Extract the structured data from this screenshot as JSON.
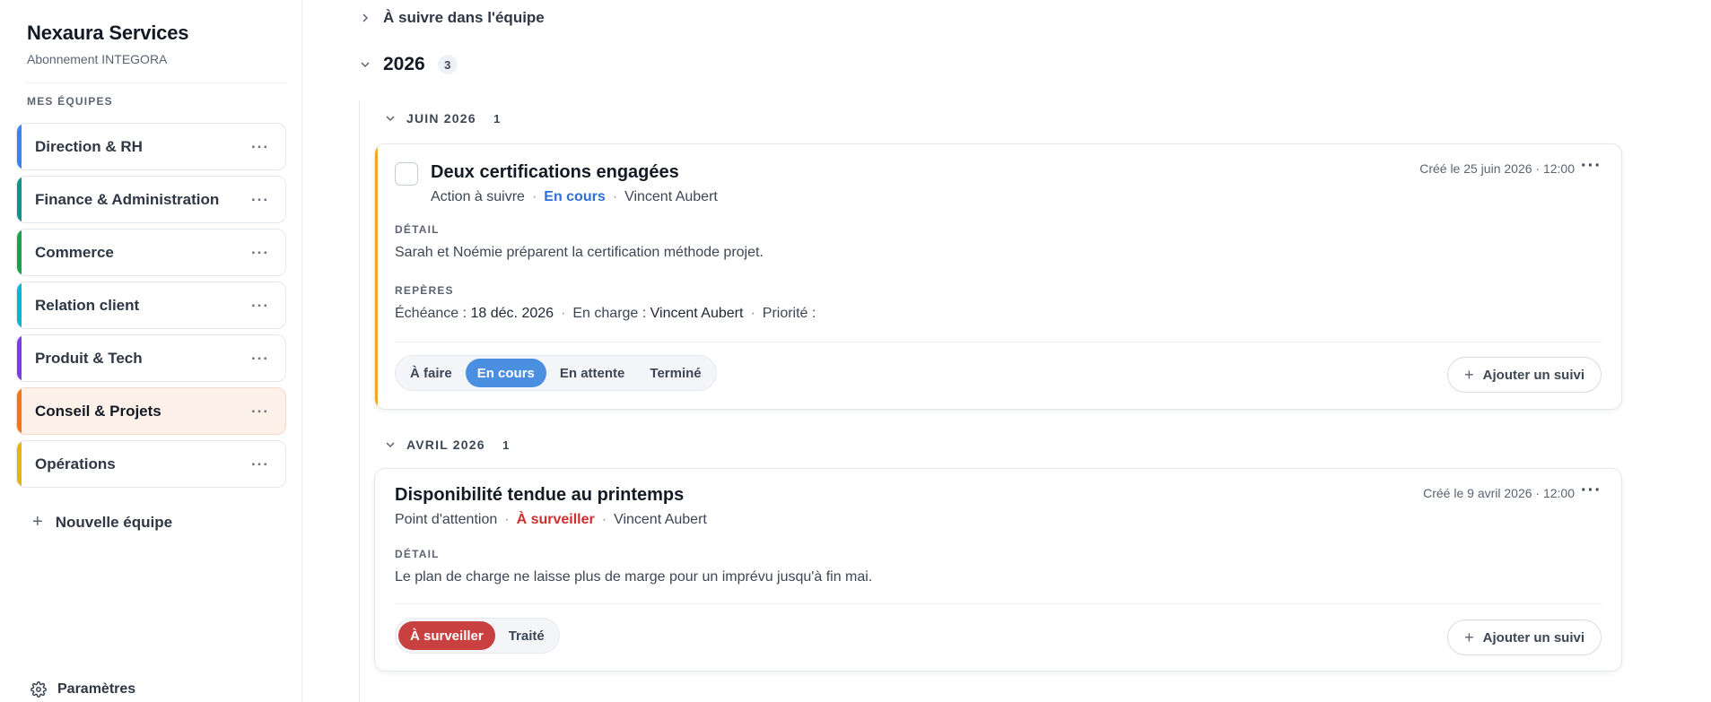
{
  "org": {
    "name": "Nexaura Services",
    "subscription": "Abonnement INTEGORA"
  },
  "sidebar": {
    "section_label": "MES ÉQUIPES",
    "teams": [
      {
        "label": "Direction & RH",
        "color": "#3b82f6"
      },
      {
        "label": "Finance & Administration",
        "color": "#0d9488"
      },
      {
        "label": "Commerce",
        "color": "#16a34a"
      },
      {
        "label": "Relation client",
        "color": "#06b6d4"
      },
      {
        "label": "Produit & Tech",
        "color": "#7c3aed"
      },
      {
        "label": "Conseil & Projets",
        "color": "#f97316",
        "active": true
      },
      {
        "label": "Opérations",
        "color": "#eab308"
      }
    ],
    "more_glyph": "···",
    "new_team_label": "Nouvelle équipe",
    "settings_label": "Paramètres"
  },
  "main": {
    "follow_label": "À suivre dans l'équipe",
    "year": {
      "label": "2026",
      "count": "3"
    },
    "months": [
      {
        "label": "JUIN 2026",
        "count": "1",
        "card": {
          "accent": "#f5a623",
          "title": "Deux certifications engagées",
          "type": "Action à suivre",
          "status": "En cours",
          "owner": "Vincent Aubert",
          "created": "Créé le 25 juin 2026 · 12:00",
          "detail_label": "DÉTAIL",
          "detail": "Sarah et Noémie préparent la certification méthode projet.",
          "reperes_label": "REPÈRES",
          "echeance_label": "Échéance :",
          "echeance": "18 déc. 2026",
          "charge_label": "En charge :",
          "charge": "Vincent Aubert",
          "priorite_label": "Priorité :",
          "options": [
            "À faire",
            "En cours",
            "En attente",
            "Terminé"
          ],
          "selected": "En cours",
          "add_label": "Ajouter un suivi"
        }
      },
      {
        "label": "AVRIL 2026",
        "count": "1",
        "card": {
          "title": "Disponibilité tendue au printemps",
          "type": "Point d'attention",
          "status": "À surveiller",
          "owner": "Vincent Aubert",
          "created": "Créé le 9 avril 2026 · 12:00",
          "detail_label": "DÉTAIL",
          "detail": "Le plan de charge ne laisse plus de marge pour un imprévu jusqu'à fin mai.",
          "options": [
            "À surveiller",
            "Traité"
          ],
          "selected": "À surveiller",
          "add_label": "Ajouter un suivi"
        }
      }
    ]
  }
}
